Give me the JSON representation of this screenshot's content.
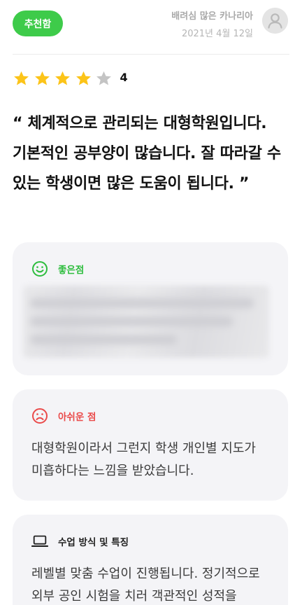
{
  "header": {
    "badge_label": "추천함",
    "author_name": "배려심 많은 카나리아",
    "review_date": "2021년 4월 12일"
  },
  "rating": {
    "stars_total": 5,
    "stars_filled": 4,
    "value_label": "4",
    "filled_color": "#fcc419",
    "empty_color": "#c4c4c4"
  },
  "review": {
    "quote": "“ 체계적으로 관리되는 대형학원입니다. 기본적인 공부양이 많습니다. 잘 따라갈 수 있는 학생이면 많은 도움이 됩니다. ”"
  },
  "sections": {
    "pros": {
      "title": "좋은점",
      "icon": "smile-icon",
      "color": "#2ebd3e"
    },
    "cons": {
      "title": "아쉬운 점",
      "icon": "sad-icon",
      "color": "#ea4a4a",
      "text": "대형학원이라서 그런지 학생 개인별 지도가 미흡하다는 느낌을 받았습니다."
    },
    "method": {
      "title": "수업 방식 및 특징",
      "icon": "laptop-icon",
      "text": "레벨별 맞춤 수업이 진행됩니다. 정기적으로 외부 공인 시험을 치러 객관적인 성적을"
    }
  }
}
